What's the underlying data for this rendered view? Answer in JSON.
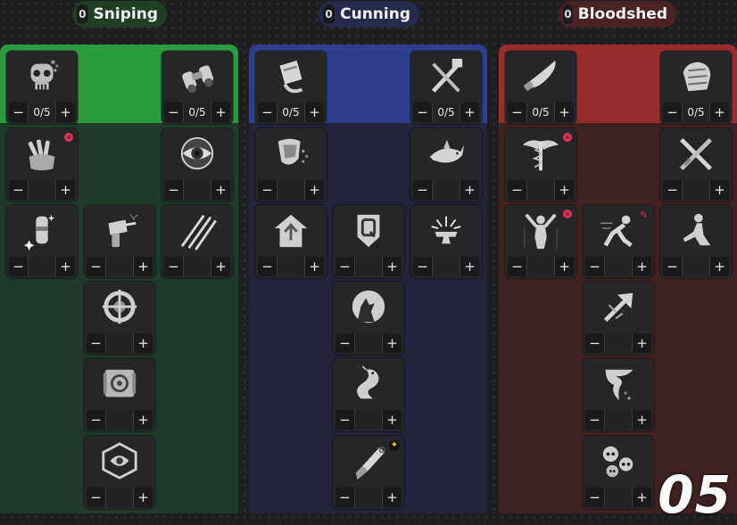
{
  "colors": {
    "sniping": "#2c9a3e",
    "sniping_dark": "#1f3a2a",
    "cunning": "#2e3f8e",
    "cunning_dark": "#23233a",
    "bloodshed": "#982d2e",
    "bloodshed_dark": "#3e2221"
  },
  "trees": [
    {
      "name": "Sniping",
      "points": "0",
      "skills": [
        {
          "icon": "pixel-skull-icon",
          "level": "0/5",
          "badge": null
        },
        {
          "icon": "binoculars-icon",
          "level": "0/5",
          "badge": null
        },
        {
          "icon": "bullets-handful-icon",
          "level": "",
          "badge": "skull"
        },
        {
          "icon": "eye-icon",
          "level": "",
          "badge": null
        },
        {
          "icon": "flask-sparkle-icon",
          "level": "",
          "badge": null
        },
        {
          "icon": "drill-icon",
          "level": "",
          "badge": null
        },
        {
          "icon": "tracer-shots-icon",
          "level": "",
          "badge": null
        },
        {
          "icon": "crosshair-icon",
          "level": "",
          "badge": null
        },
        {
          "icon": "target-scroll-icon",
          "level": "",
          "badge": null
        },
        {
          "icon": "eye-badge-icon",
          "level": "",
          "badge": null
        }
      ]
    },
    {
      "name": "Cunning",
      "points": "0",
      "skills": [
        {
          "icon": "ammo-clip-icon",
          "level": "0/5",
          "badge": null
        },
        {
          "icon": "crossed-tools-icon",
          "level": "0/5",
          "badge": null
        },
        {
          "icon": "dissolving-shield-icon",
          "level": "",
          "badge": null
        },
        {
          "icon": "shark-icon",
          "level": "",
          "badge": null
        },
        {
          "icon": "house-shield-icon",
          "level": "",
          "badge": null
        },
        {
          "icon": "q-badge-icon",
          "level": "",
          "badge": null
        },
        {
          "icon": "anvil-blast-icon",
          "level": "",
          "badge": null
        },
        {
          "icon": "howling-wolf-icon",
          "level": "",
          "badge": null
        },
        {
          "icon": "serpent-icon",
          "level": "",
          "badge": null
        },
        {
          "icon": "kunai-icon",
          "level": "",
          "badge": "star"
        }
      ]
    },
    {
      "name": "Bloodshed",
      "points": "0",
      "skills": [
        {
          "icon": "machete-icon",
          "level": "0/5",
          "badge": null
        },
        {
          "icon": "armor-gauntlet-icon",
          "level": "0/5",
          "badge": null
        },
        {
          "icon": "winged-caduceus-icon",
          "level": "",
          "badge": "skull"
        },
        {
          "icon": "crossed-swords-icon",
          "level": "",
          "badge": null
        },
        {
          "icon": "arms-raised-icon",
          "level": "",
          "badge": "skull"
        },
        {
          "icon": "dashing-figure-icon",
          "level": "",
          "badge": "pencil"
        },
        {
          "icon": "kneeling-figure-icon",
          "level": "",
          "badge": null
        },
        {
          "icon": "arrow-burst-icon",
          "level": "",
          "badge": null
        },
        {
          "icon": "tornado-icon",
          "level": "",
          "badge": null
        },
        {
          "icon": "skull-pile-icon",
          "level": "",
          "badge": null
        }
      ]
    }
  ],
  "watermark": "05"
}
